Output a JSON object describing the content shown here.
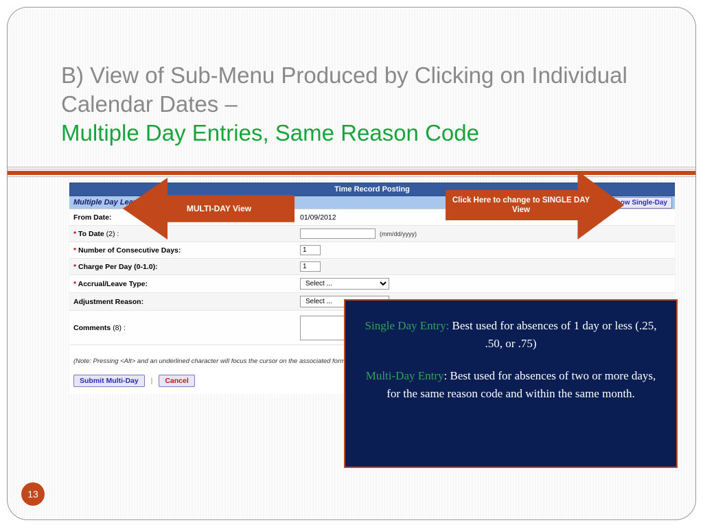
{
  "title": {
    "gray": "B) View of Sub-Menu Produced by Clicking on Individual Calendar Dates –",
    "green": "Multiple Day Entries, Same Reason Code"
  },
  "arrows": {
    "left": "MULTI-DAY View",
    "right": "Click Here to change to SINGLE DAY View"
  },
  "app": {
    "header": "Time Record Posting",
    "section_label": "Multiple Day Leave",
    "show_single": "Show Single-Day"
  },
  "form": {
    "from_label": "From Date:",
    "from_value": "01/09/2012",
    "to_label": "To Date",
    "to_suffix": "(2) :",
    "to_hint": "(mm/dd/yyyy)",
    "days_label": "Number of Consecutive Days:",
    "days_value": "1",
    "charge_label": "Charge Per Day (0-1.0):",
    "charge_value": "1",
    "accrual_label": "Accrual/Leave Type:",
    "accrual_value": "Select ...",
    "adjust_label": "Adjustment Reason:",
    "adjust_value": "Select ...",
    "comments_label": "Comments",
    "comments_suffix": "(8) :",
    "note": "(Note: Pressing <Alt> and an underlined character will focus the cursor on the associated form field.)",
    "submit": "Submit Multi-Day",
    "cancel": "Cancel",
    "sep": "|"
  },
  "info": {
    "l1a": "Single Day Entry:",
    "l1b": " Best used for absences of 1 day or less (.25, .50, or .75)",
    "l2a": "Multi-Day Entry",
    "l2b": ": Best used for absences of two or more days, for the same reason code and within the same month."
  },
  "page_number": "13"
}
